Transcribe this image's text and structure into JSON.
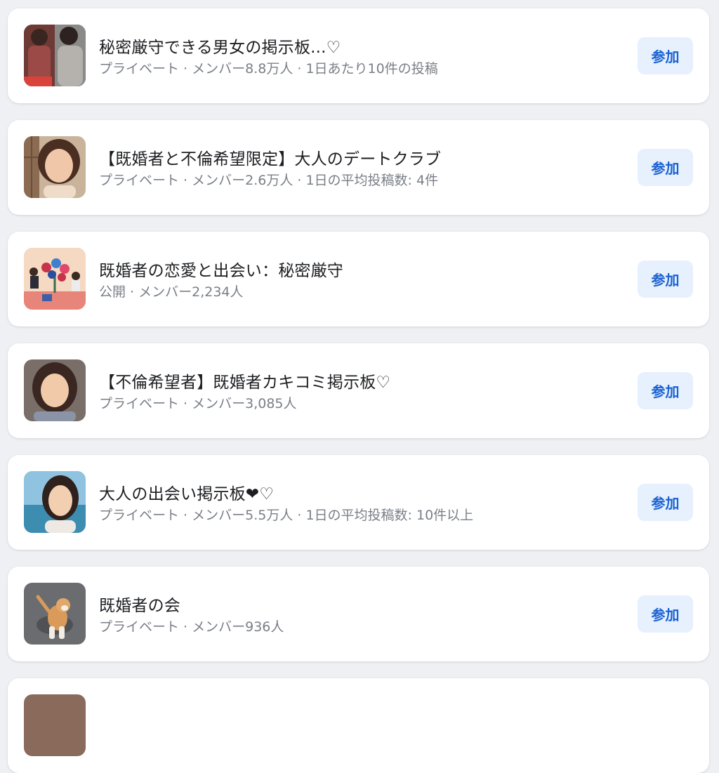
{
  "groups": [
    {
      "title": "秘密厳守できる男女の掲示板...♡",
      "meta": "プライベート · メンバー8.8万人 · 1日あたり10件の投稿",
      "join_label": "参加",
      "thumb_icon": "group-photo-two-women"
    },
    {
      "title": "【既婚者と不倫希望限定】大人のデートクラブ",
      "meta": "プライベート · メンバー2.6万人 · 1日の平均投稿数: 4件",
      "join_label": "参加",
      "thumb_icon": "group-photo-woman"
    },
    {
      "title": "既婚者の恋愛と出会い：秘密厳守",
      "meta": "公開 · メンバー2,234人",
      "join_label": "参加",
      "thumb_icon": "group-illustration-flowers"
    },
    {
      "title": "【不倫希望者】既婚者カキコミ掲示板♡",
      "meta": "プライベート · メンバー3,085人",
      "join_label": "参加",
      "thumb_icon": "group-photo-woman"
    },
    {
      "title": "大人の出会い掲示板❤︎♡",
      "meta": "プライベート · メンバー5.5万人 · 1日の平均投稿数: 10件以上",
      "join_label": "参加",
      "thumb_icon": "group-photo-woman-seaside"
    },
    {
      "title": "既婚者の会",
      "meta": "プライベート · メンバー936人",
      "join_label": "参加",
      "thumb_icon": "group-photo-dog"
    }
  ],
  "colors": {
    "background": "#eef0f4",
    "card": "#ffffff",
    "join_bg": "#e7f0fd",
    "join_text": "#1b62d2",
    "meta_text": "#7a7f87"
  }
}
